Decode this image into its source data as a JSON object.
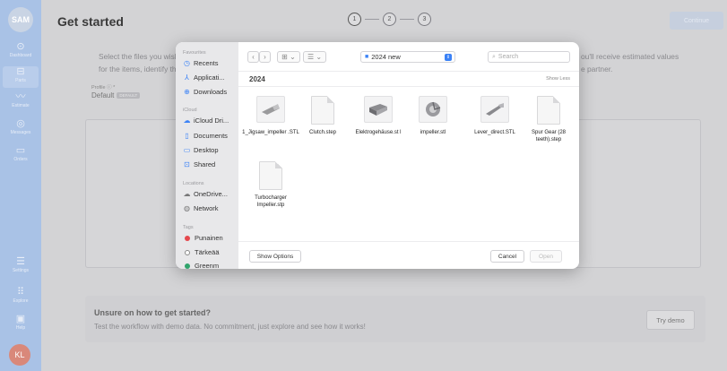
{
  "sidebar": {
    "logo": "SAM",
    "items": [
      {
        "label": "Dashboard",
        "icon": "dashboard-icon",
        "glyph": "⊙"
      },
      {
        "label": "Parts",
        "icon": "parts-icon",
        "glyph": "⊟"
      },
      {
        "label": "Estimate",
        "icon": "estimate-icon",
        "glyph": "〰"
      },
      {
        "label": "Messages",
        "icon": "messages-icon",
        "glyph": "◎"
      },
      {
        "label": "Orders",
        "icon": "orders-icon",
        "glyph": "▭"
      }
    ],
    "bottom_items": [
      {
        "label": "Settings",
        "icon": "settings-icon",
        "glyph": "☰"
      },
      {
        "label": "Explore",
        "icon": "explore-icon",
        "glyph": "⠿"
      },
      {
        "label": "Help",
        "icon": "help-icon",
        "glyph": "▣"
      }
    ],
    "avatar": "KL"
  },
  "header": {
    "title": "Get started",
    "steps": [
      "1",
      "2",
      "3"
    ],
    "continue_label": "Continue"
  },
  "intro": {
    "line1": "Select the files you wish",
    "line2": "for the items, identify th",
    "right_line1": "ou'll receive estimated values",
    "right_line2": "e partner."
  },
  "profile": {
    "label": "Profile ⓘ *",
    "value": "Default",
    "badge": "DEFAULT"
  },
  "help": {
    "title": "Unsure on how to get started?",
    "subtitle": "Test the workflow with demo data. No commitment, just explore and see how it works!",
    "try_label": "Try demo"
  },
  "dialog": {
    "favourites_label": "Favourites",
    "favourites": [
      {
        "label": "Recents",
        "icon": "clock-icon",
        "glyph": "◷"
      },
      {
        "label": "Applicati...",
        "icon": "applications-icon",
        "glyph": "⅄"
      },
      {
        "label": "Downloads",
        "icon": "download-icon",
        "glyph": "⊕"
      }
    ],
    "icloud_label": "iCloud",
    "icloud": [
      {
        "label": "iCloud Dri...",
        "icon": "cloud-icon",
        "glyph": "☁"
      },
      {
        "label": "Documents",
        "icon": "document-icon",
        "glyph": "▯"
      },
      {
        "label": "Desktop",
        "icon": "desktop-icon",
        "glyph": "▭"
      },
      {
        "label": "Shared",
        "icon": "shared-folder-icon",
        "glyph": "⊡"
      }
    ],
    "locations_label": "Locations",
    "locations": [
      {
        "label": "OneDrive...",
        "icon": "cloud-icon",
        "glyph": "☁"
      },
      {
        "label": "Network",
        "icon": "network-icon",
        "glyph": "◍"
      }
    ],
    "tags_label": "Tags",
    "tags": [
      {
        "label": "Punainen",
        "color": "#e5484d"
      },
      {
        "label": "Tärkeää",
        "color": "#ffffff"
      },
      {
        "label": "Greenm",
        "color": "#30a46c"
      }
    ],
    "toolbar": {
      "back": "‹",
      "forward": "›",
      "grid_view": "⊞ ⌄",
      "list_view": "☰ ⌄",
      "folder": "2024 new",
      "search_placeholder": "Search"
    },
    "group": "2024",
    "show_less": "Show Less",
    "files": [
      {
        "name": "1_Jigsaw_impeller .STL",
        "kind": "render"
      },
      {
        "name": "Clutch.step",
        "kind": "doc"
      },
      {
        "name": "Elektrogehäuse.st l",
        "kind": "render"
      },
      {
        "name": "impeller.stl",
        "kind": "render"
      },
      {
        "name": "Lever_direct.STL",
        "kind": "render"
      },
      {
        "name": "Spur Gear (28 teeth).step",
        "kind": "doc"
      },
      {
        "name": "Turbocharger Impeller.stp",
        "kind": "doc"
      }
    ],
    "show_options": "Show Options",
    "cancel": "Cancel",
    "open": "Open"
  }
}
